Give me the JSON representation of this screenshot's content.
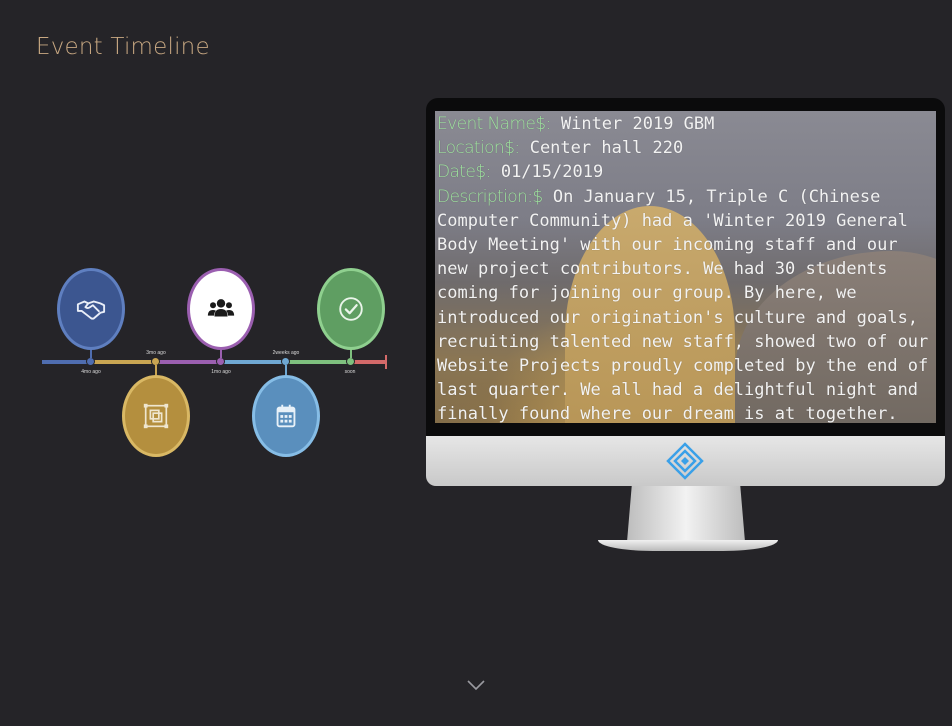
{
  "page": {
    "title": "Event Timeline"
  },
  "timeline": {
    "labels_below": [
      "4mo ago",
      "1mo ago",
      "soon"
    ],
    "labels_above": [
      "3mo ago",
      "2weeks ago"
    ],
    "colors": {
      "blue": "#4f6db0",
      "gold": "#c9a552",
      "purple": "#9b5fb0",
      "lightblue": "#6fa8d3",
      "green": "#7ec07e",
      "red": "#d46a6a"
    },
    "events": [
      {
        "icon": "handshake-icon"
      },
      {
        "icon": "frame-icon"
      },
      {
        "icon": "group-icon"
      },
      {
        "icon": "calendar-icon"
      },
      {
        "icon": "check-circle-icon"
      }
    ]
  },
  "monitor": {
    "name_label": "Event Name$:",
    "name_value": "Winter 2019 GBM",
    "location_label": "Location$:",
    "location_value": "Center hall 220",
    "date_label": "Date$:",
    "date_value": "01/15/2019",
    "description_label": "Description:$",
    "description_value": "On January 15, Triple C (Chinese Computer Community) had a 'Winter 2019 General Body Meeting' with our incoming staff and our new project contributors. We had 30 students coming for joining our group. By here, we introduced our origination's culture and goals, recruiting talented new staff, showed two of our Website Projects proudly completed by the end of last quarter. We all had a delightful night and finally found where our dream is at together."
  }
}
